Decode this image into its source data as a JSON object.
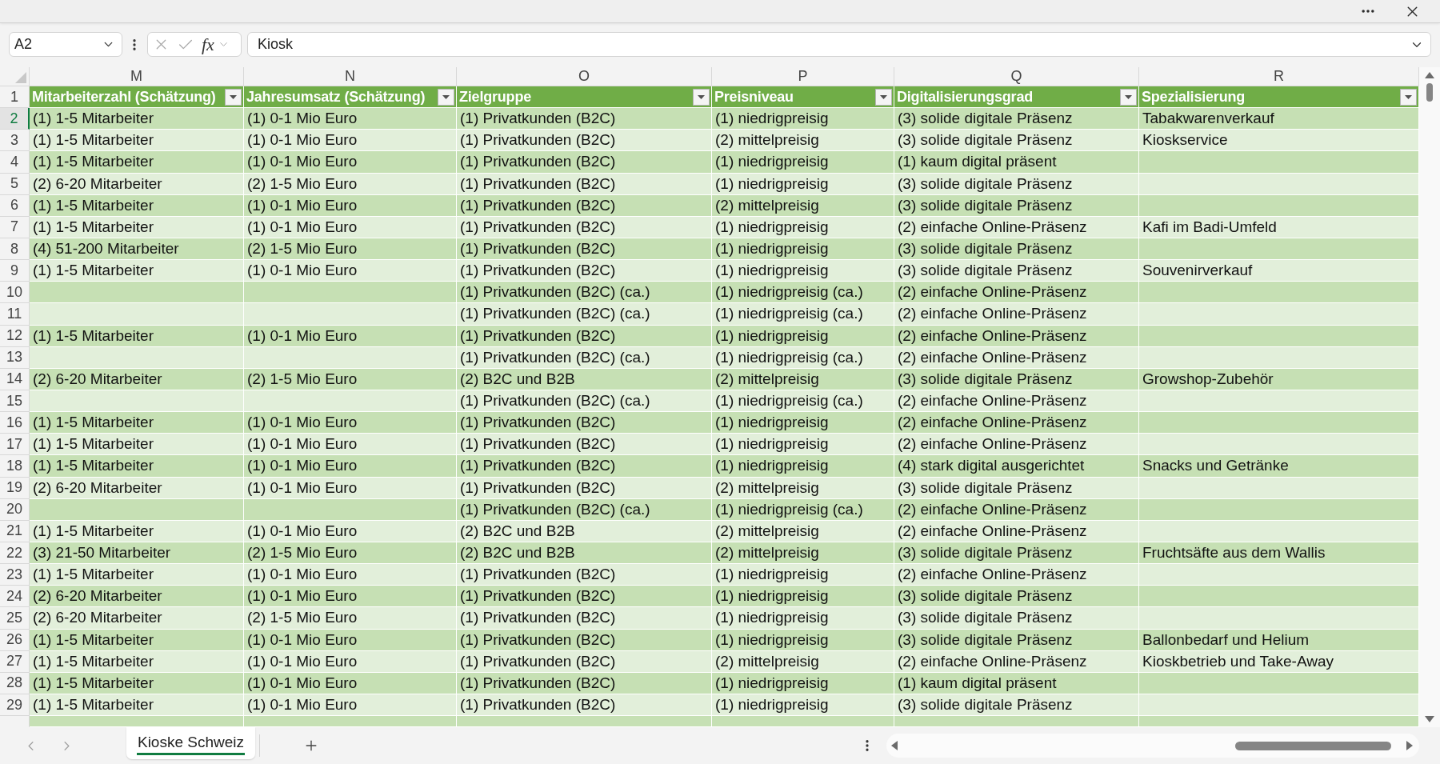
{
  "formula_bar": {
    "name_box": "A2",
    "function_label": "fx",
    "formula": "Kiosk"
  },
  "sheet": {
    "columns": [
      {
        "letter": "M",
        "header": "Mitarbeiterzahl (Schätzung)"
      },
      {
        "letter": "N",
        "header": "Jahresumsatz (Schätzung)"
      },
      {
        "letter": "O",
        "header": "Zielgruppe"
      },
      {
        "letter": "P",
        "header": "Preisniveau"
      },
      {
        "letter": "Q",
        "header": "Digitalisierungsgrad"
      },
      {
        "letter": "R",
        "header": "Spezialisierung"
      }
    ],
    "header_row": {
      "number": "1",
      "selected": false
    },
    "rows": [
      {
        "number": "2",
        "selected": true,
        "mitarbeiterzahl": "(1) 1-5 Mitarbeiter",
        "jahresumsatz": "(1) 0-1 Mio Euro",
        "zielgruppe": "(1) Privatkunden (B2C)",
        "preisniveau": "(1) niedrigpreisig",
        "digitalisierungsgrad": "(3) solide digitale Präsenz",
        "spezialisierung": "Tabakwarenverkauf"
      },
      {
        "number": "3",
        "selected": false,
        "mitarbeiterzahl": "(1) 1-5 Mitarbeiter",
        "jahresumsatz": "(1) 0-1 Mio Euro",
        "zielgruppe": "(1) Privatkunden (B2C)",
        "preisniveau": "(2) mittelpreisig",
        "digitalisierungsgrad": "(3) solide digitale Präsenz",
        "spezialisierung": "Kioskservice"
      },
      {
        "number": "4",
        "selected": false,
        "mitarbeiterzahl": "(1) 1-5 Mitarbeiter",
        "jahresumsatz": "(1) 0-1 Mio Euro",
        "zielgruppe": "(1) Privatkunden (B2C)",
        "preisniveau": "(1) niedrigpreisig",
        "digitalisierungsgrad": "(1) kaum digital präsent"
      },
      {
        "number": "5",
        "selected": false,
        "mitarbeiterzahl": "(2) 6-20 Mitarbeiter",
        "jahresumsatz": "(2) 1-5 Mio Euro",
        "zielgruppe": "(1) Privatkunden (B2C)",
        "preisniveau": "(1) niedrigpreisig",
        "digitalisierungsgrad": "(3) solide digitale Präsenz"
      },
      {
        "number": "6",
        "selected": false,
        "mitarbeiterzahl": "(1) 1-5 Mitarbeiter",
        "jahresumsatz": "(1) 0-1 Mio Euro",
        "zielgruppe": "(1) Privatkunden (B2C)",
        "preisniveau": "(2) mittelpreisig",
        "digitalisierungsgrad": "(3) solide digitale Präsenz"
      },
      {
        "number": "7",
        "selected": false,
        "mitarbeiterzahl": "(1) 1-5 Mitarbeiter",
        "jahresumsatz": "(1) 0-1 Mio Euro",
        "zielgruppe": "(1) Privatkunden (B2C)",
        "preisniveau": "(1) niedrigpreisig",
        "digitalisierungsgrad": "(2) einfache Online-Präsenz",
        "spezialisierung": "Kafi im Badi-Umfeld"
      },
      {
        "number": "8",
        "selected": false,
        "mitarbeiterzahl": "(4) 51-200 Mitarbeiter",
        "jahresumsatz": "(2) 1-5 Mio Euro",
        "zielgruppe": "(1) Privatkunden (B2C)",
        "preisniveau": "(1) niedrigpreisig",
        "digitalisierungsgrad": "(3) solide digitale Präsenz"
      },
      {
        "number": "9",
        "selected": false,
        "mitarbeiterzahl": "(1) 1-5 Mitarbeiter",
        "jahresumsatz": "(1) 0-1 Mio Euro",
        "zielgruppe": "(1) Privatkunden (B2C)",
        "preisniveau": "(1) niedrigpreisig",
        "digitalisierungsgrad": "(3) solide digitale Präsenz",
        "spezialisierung": "Souvenirverkauf"
      },
      {
        "number": "10",
        "selected": false,
        "zielgruppe": "(1) Privatkunden (B2C) (ca.)",
        "preisniveau": "(1) niedrigpreisig (ca.)",
        "digitalisierungsgrad": "(2) einfache Online-Präsenz"
      },
      {
        "number": "11",
        "selected": false,
        "zielgruppe": "(1) Privatkunden (B2C) (ca.)",
        "preisniveau": "(1) niedrigpreisig (ca.)",
        "digitalisierungsgrad": "(2) einfache Online-Präsenz"
      },
      {
        "number": "12",
        "selected": false,
        "mitarbeiterzahl": "(1) 1-5 Mitarbeiter",
        "jahresumsatz": "(1) 0-1 Mio Euro",
        "zielgruppe": "(1) Privatkunden (B2C)",
        "preisniveau": "(1) niedrigpreisig",
        "digitalisierungsgrad": "(2) einfache Online-Präsenz"
      },
      {
        "number": "13",
        "selected": false,
        "zielgruppe": "(1) Privatkunden (B2C) (ca.)",
        "preisniveau": "(1) niedrigpreisig (ca.)",
        "digitalisierungsgrad": "(2) einfache Online-Präsenz"
      },
      {
        "number": "14",
        "selected": false,
        "mitarbeiterzahl": "(2) 6-20 Mitarbeiter",
        "jahresumsatz": "(2) 1-5 Mio Euro",
        "zielgruppe": "(2) B2C und B2B",
        "preisniveau": "(2) mittelpreisig",
        "digitalisierungsgrad": "(3) solide digitale Präsenz",
        "spezialisierung": "Growshop-Zubehör"
      },
      {
        "number": "15",
        "selected": false,
        "zielgruppe": "(1) Privatkunden (B2C) (ca.)",
        "preisniveau": "(1) niedrigpreisig (ca.)",
        "digitalisierungsgrad": "(2) einfache Online-Präsenz"
      },
      {
        "number": "16",
        "selected": false,
        "mitarbeiterzahl": "(1) 1-5 Mitarbeiter",
        "jahresumsatz": "(1) 0-1 Mio Euro",
        "zielgruppe": "(1) Privatkunden (B2C)",
        "preisniveau": "(1) niedrigpreisig",
        "digitalisierungsgrad": "(2) einfache Online-Präsenz"
      },
      {
        "number": "17",
        "selected": false,
        "mitarbeiterzahl": "(1) 1-5 Mitarbeiter",
        "jahresumsatz": "(1) 0-1 Mio Euro",
        "zielgruppe": "(1) Privatkunden (B2C)",
        "preisniveau": "(1) niedrigpreisig",
        "digitalisierungsgrad": "(2) einfache Online-Präsenz"
      },
      {
        "number": "18",
        "selected": false,
        "mitarbeiterzahl": "(1) 1-5 Mitarbeiter",
        "jahresumsatz": "(1) 0-1 Mio Euro",
        "zielgruppe": "(1) Privatkunden (B2C)",
        "preisniveau": "(1) niedrigpreisig",
        "digitalisierungsgrad": "(4) stark digital ausgerichtet",
        "spezialisierung": "Snacks und Getränke"
      },
      {
        "number": "19",
        "selected": false,
        "mitarbeiterzahl": "(2) 6-20 Mitarbeiter",
        "jahresumsatz": "(1) 0-1 Mio Euro",
        "zielgruppe": "(1) Privatkunden (B2C)",
        "preisniveau": "(2) mittelpreisig",
        "digitalisierungsgrad": "(3) solide digitale Präsenz"
      },
      {
        "number": "20",
        "selected": false,
        "zielgruppe": "(1) Privatkunden (B2C) (ca.)",
        "preisniveau": "(1) niedrigpreisig (ca.)",
        "digitalisierungsgrad": "(2) einfache Online-Präsenz"
      },
      {
        "number": "21",
        "selected": false,
        "mitarbeiterzahl": "(1) 1-5 Mitarbeiter",
        "jahresumsatz": "(1) 0-1 Mio Euro",
        "zielgruppe": "(2) B2C und B2B",
        "preisniveau": "(2) mittelpreisig",
        "digitalisierungsgrad": "(2) einfache Online-Präsenz"
      },
      {
        "number": "22",
        "selected": false,
        "mitarbeiterzahl": "(3) 21-50 Mitarbeiter",
        "jahresumsatz": "(2) 1-5 Mio Euro",
        "zielgruppe": "(2) B2C und B2B",
        "preisniveau": "(2) mittelpreisig",
        "digitalisierungsgrad": "(3) solide digitale Präsenz",
        "spezialisierung": "Fruchtsäfte aus dem Wallis"
      },
      {
        "number": "23",
        "selected": false,
        "mitarbeiterzahl": "(1) 1-5 Mitarbeiter",
        "jahresumsatz": "(1) 0-1 Mio Euro",
        "zielgruppe": "(1) Privatkunden (B2C)",
        "preisniveau": "(1) niedrigpreisig",
        "digitalisierungsgrad": "(2) einfache Online-Präsenz"
      },
      {
        "number": "24",
        "selected": false,
        "mitarbeiterzahl": "(2) 6-20 Mitarbeiter",
        "jahresumsatz": "(1) 0-1 Mio Euro",
        "zielgruppe": "(1) Privatkunden (B2C)",
        "preisniveau": "(1) niedrigpreisig",
        "digitalisierungsgrad": "(3) solide digitale Präsenz"
      },
      {
        "number": "25",
        "selected": false,
        "mitarbeiterzahl": "(2) 6-20 Mitarbeiter",
        "jahresumsatz": "(2) 1-5 Mio Euro",
        "zielgruppe": "(1) Privatkunden (B2C)",
        "preisniveau": "(1) niedrigpreisig",
        "digitalisierungsgrad": "(3) solide digitale Präsenz"
      },
      {
        "number": "26",
        "selected": false,
        "mitarbeiterzahl": "(1) 1-5 Mitarbeiter",
        "jahresumsatz": "(1) 0-1 Mio Euro",
        "zielgruppe": "(1) Privatkunden (B2C)",
        "preisniveau": "(1) niedrigpreisig",
        "digitalisierungsgrad": "(3) solide digitale Präsenz",
        "spezialisierung": "Ballonbedarf und Helium"
      },
      {
        "number": "27",
        "selected": false,
        "mitarbeiterzahl": "(1) 1-5 Mitarbeiter",
        "jahresumsatz": "(1) 0-1 Mio Euro",
        "zielgruppe": "(1) Privatkunden (B2C)",
        "preisniveau": "(2) mittelpreisig",
        "digitalisierungsgrad": "(2) einfache Online-Präsenz",
        "spezialisierung": "Kioskbetrieb und Take-Away"
      },
      {
        "number": "28",
        "selected": false,
        "mitarbeiterzahl": "(1) 1-5 Mitarbeiter",
        "jahresumsatz": "(1) 0-1 Mio Euro",
        "zielgruppe": "(1) Privatkunden (B2C)",
        "preisniveau": "(1) niedrigpreisig",
        "digitalisierungsgrad": "(1) kaum digital präsent"
      },
      {
        "number": "29",
        "selected": false,
        "mitarbeiterzahl": "(1) 1-5 Mitarbeiter",
        "jahresumsatz": "(1) 0-1 Mio Euro",
        "zielgruppe": "(1) Privatkunden (B2C)",
        "preisniveau": "(1) niedrigpreisig",
        "digitalisierungsgrad": "(3) solide digitale Präsenz"
      }
    ]
  },
  "sheet_tabs": [
    {
      "label": "Kioske Schweiz",
      "selected": true
    }
  ]
}
